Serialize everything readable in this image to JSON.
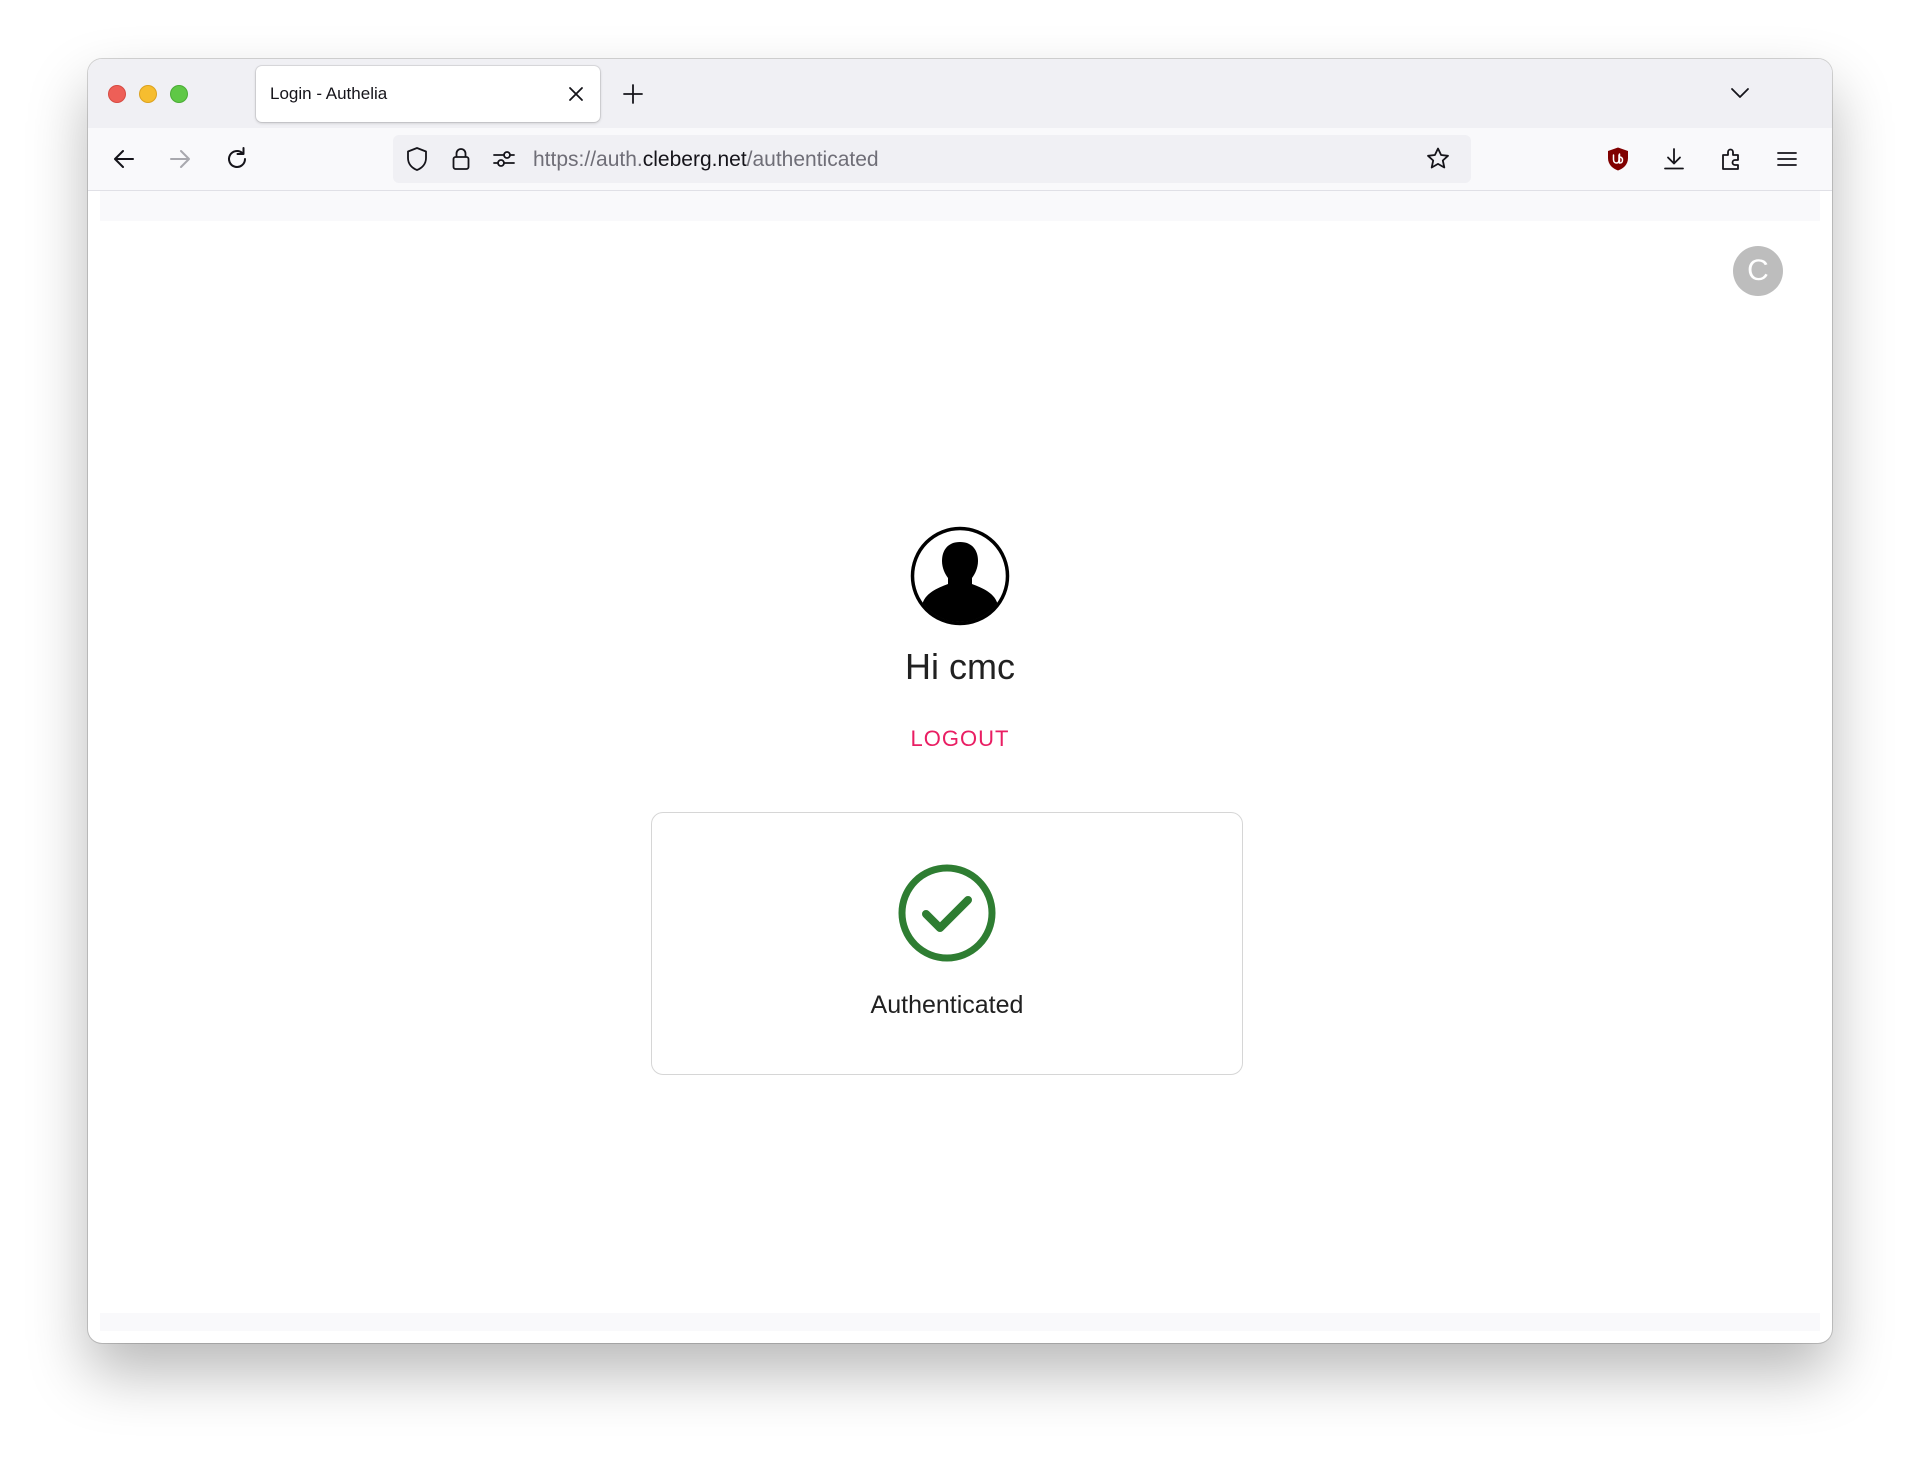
{
  "browser": {
    "tab": {
      "title": "Login - Authelia"
    },
    "url": {
      "scheme_prefix": "https://auth.",
      "host": "cleberg.net",
      "path": "/authenticated"
    }
  },
  "page": {
    "account_initial": "C",
    "greeting": "Hi cmc",
    "logout_label": "LOGOUT",
    "status_label": "Authenticated"
  },
  "colors": {
    "accent": "#e91e63",
    "success": "#2e7d32",
    "ublock": "#800000"
  },
  "icons": [
    "close-icon",
    "plus-icon",
    "chevron-down-icon",
    "back-arrow-icon",
    "forward-arrow-icon",
    "reload-icon",
    "shield-icon",
    "lock-icon",
    "permissions-icon",
    "star-icon",
    "ublock-icon",
    "download-icon",
    "extensions-icon",
    "menu-icon",
    "user-icon",
    "check-circle-icon"
  ]
}
